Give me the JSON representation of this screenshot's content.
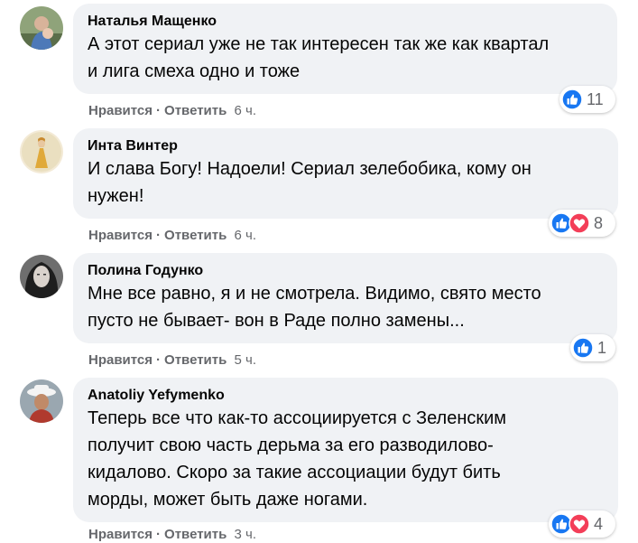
{
  "comments": [
    {
      "author": "Наталья Мащенко",
      "lines": [
        "А этот сериал уже не так интересен так же как квартал",
        "и лига смеха одно и тоже"
      ],
      "like_label": "Нравится",
      "reply_label": "Ответить",
      "time": "6 ч.",
      "reaction_count": "11",
      "reactions": [
        "like"
      ]
    },
    {
      "author": "Инта Винтер",
      "lines": [
        "И слава Богу! Надоели! Сериал зелебобика, кому он",
        "нужен!"
      ],
      "like_label": "Нравится",
      "reply_label": "Ответить",
      "time": "6 ч.",
      "reaction_count": "8",
      "reactions": [
        "like",
        "love"
      ]
    },
    {
      "author": "Полина Годунко",
      "lines": [
        "Мне все равно, я и не смотрела. Видимо, свято место",
        "пусто не бывает- вон в Раде полно замены..."
      ],
      "like_label": "Нравится",
      "reply_label": "Ответить",
      "time": "5 ч.",
      "reaction_count": "1",
      "reactions": [
        "like"
      ]
    },
    {
      "author": "Anatoliy Yefymenko",
      "lines": [
        "Теперь все что как-то ассоциируется с Зеленским",
        "получит свою часть дерьма за его разводилово-",
        "кидалово. Скоро за такие ассоциации будут бить",
        "морды, может быть даже ногами."
      ],
      "like_label": "Нравится",
      "reply_label": "Ответить",
      "time": "3 ч.",
      "reaction_count": "4",
      "reactions": [
        "like",
        "love"
      ]
    }
  ],
  "separator": "·",
  "colors": {
    "bubble": "#f0f2f5",
    "secondary_text": "#65676b",
    "like_blue": "#1877f2",
    "love_red": "#f33e58"
  }
}
